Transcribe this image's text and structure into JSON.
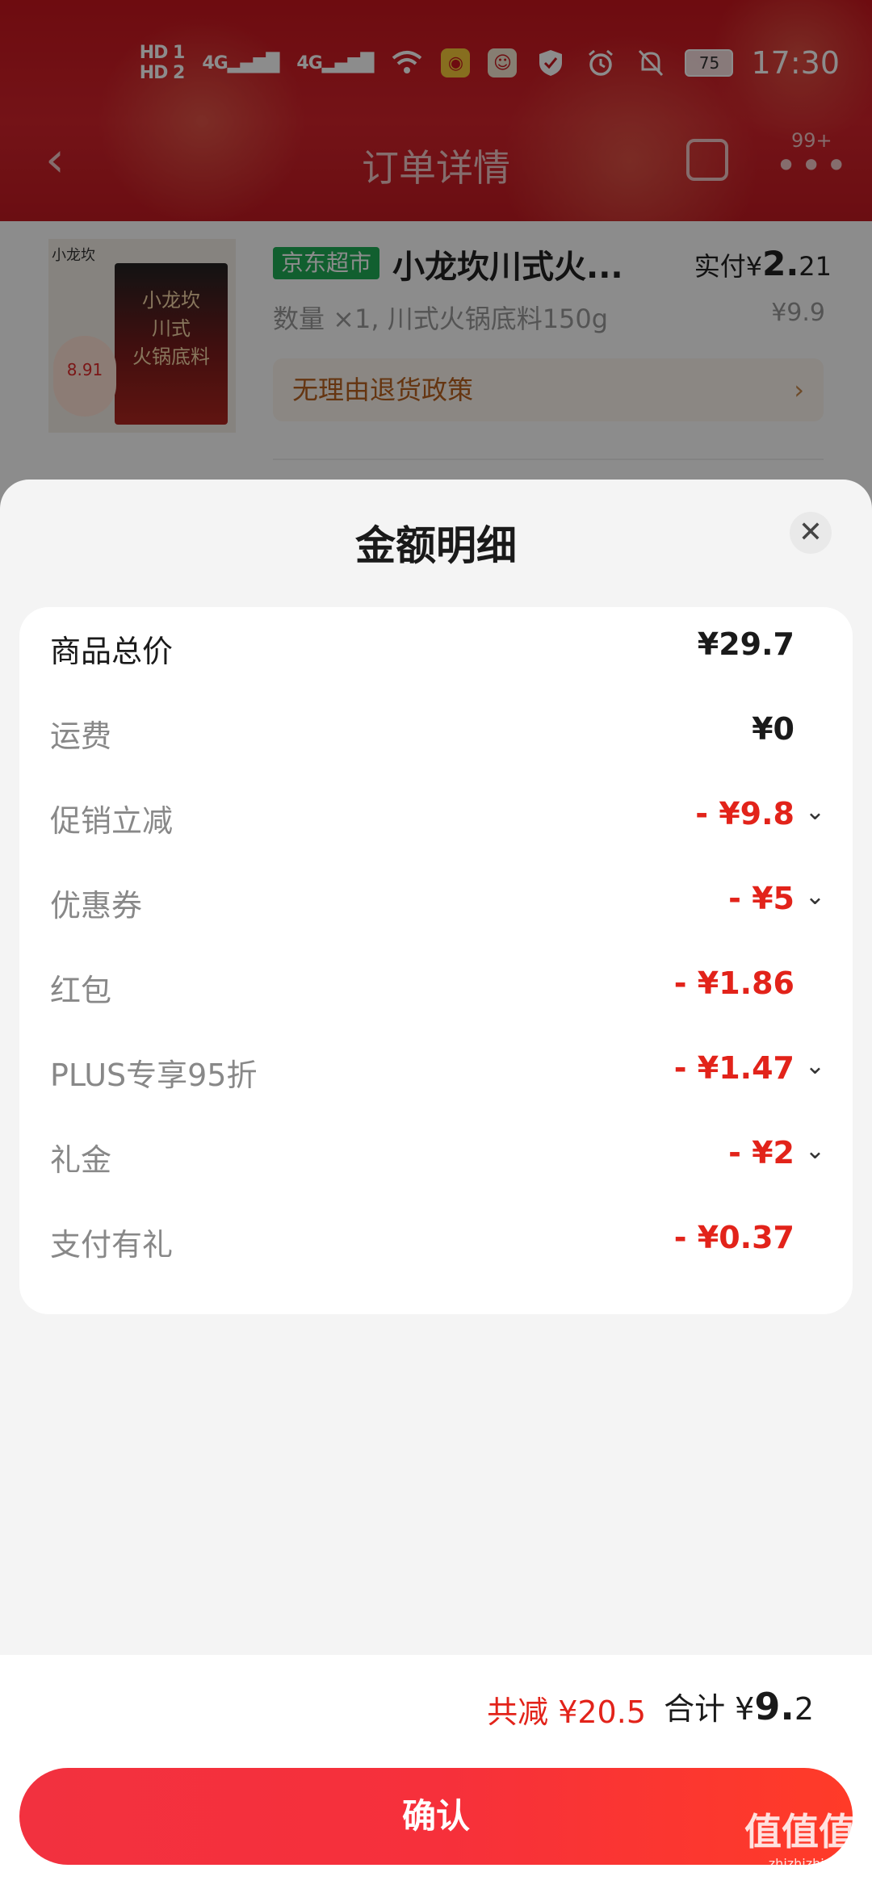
{
  "status_bar": {
    "sim1": "HD 1",
    "sim2": "HD 2",
    "signal1": "4G",
    "signal2": "4G",
    "battery": "75",
    "time": "17:30"
  },
  "nav": {
    "title": "订单详情",
    "badge": "99+"
  },
  "order": {
    "store_tag": "京东超市",
    "product_title": "小龙坎川式火...",
    "paid_label": "实付¥",
    "paid_int": "2.",
    "paid_dec": "21",
    "spec": "数量 ×1, 川式火锅底料150g",
    "original_price": "¥9.9",
    "return_policy": "无理由退货政策",
    "image_brand": "小龙坎",
    "image_pack_text": "小龙坎\n川式\n火锅底料",
    "image_price_tag": "8.91"
  },
  "sheet": {
    "title": "金额明细",
    "rows": [
      {
        "label": "商品总价",
        "value": "¥29.7"
      },
      {
        "label": "运费",
        "value": "¥0"
      },
      {
        "label": "促销立减",
        "value": "- ¥9.8"
      },
      {
        "label": "优惠券",
        "value": "- ¥5"
      },
      {
        "label": "红包",
        "value": "- ¥1.86"
      },
      {
        "label": "PLUS专享95折",
        "value": "- ¥1.47"
      },
      {
        "label": "礼金",
        "value": "- ¥2"
      },
      {
        "label": "支付有礼",
        "value": "- ¥0.37"
      }
    ],
    "summary_reduce": "共减 ¥20.5",
    "summary_total_label": "合计 ¥",
    "summary_total_int": "9.",
    "summary_total_dec": "2",
    "confirm": "确认"
  },
  "watermark": {
    "title": "值值值",
    "url": "zhizhizhi.com"
  },
  "colors": {
    "accent_red": "#e2231a",
    "brand_green": "#1fae56"
  }
}
